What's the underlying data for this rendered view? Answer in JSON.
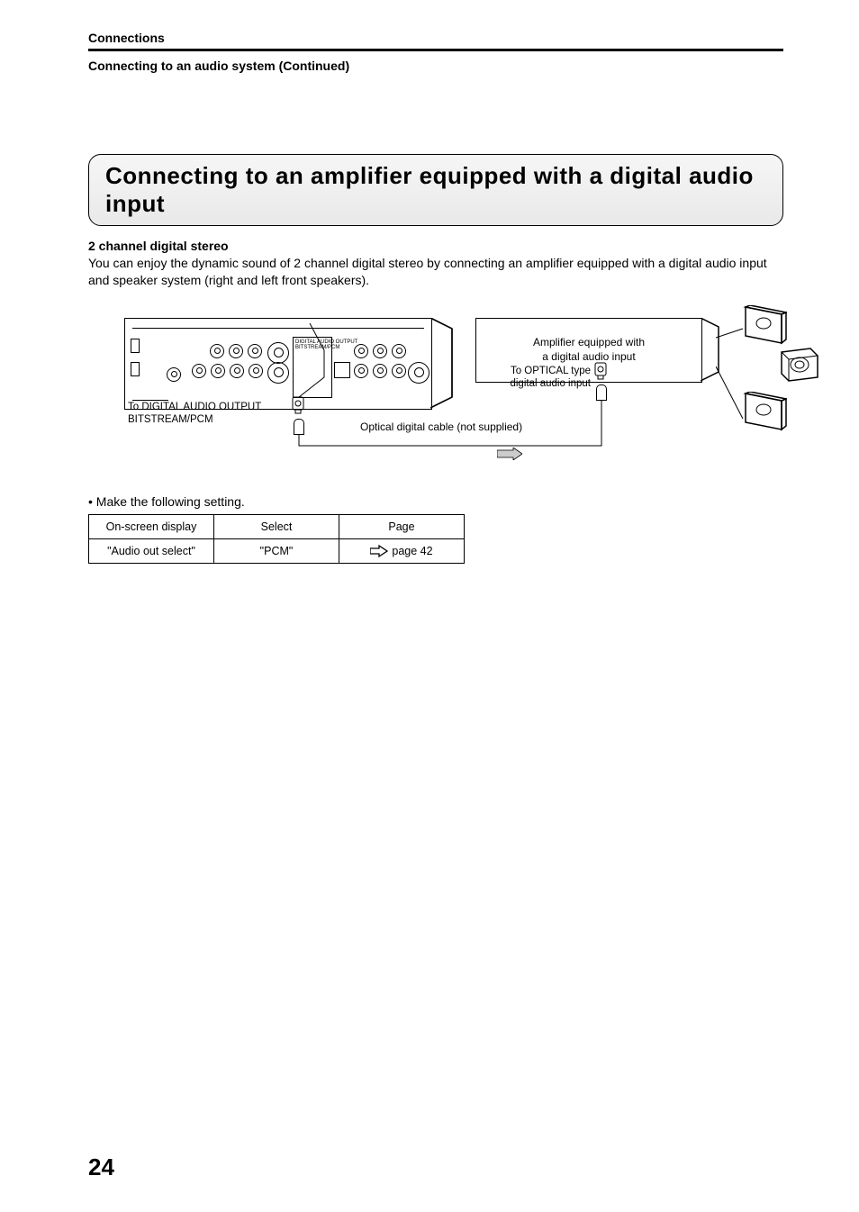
{
  "header": {
    "running": "Connections",
    "subsection": "Connecting to an audio system (Continued)"
  },
  "section": {
    "title": "Connecting to an amplifier equipped with a digital audio input",
    "subtitle": "2 channel digital stereo",
    "body": "You can enjoy the dynamic sound of 2 channel digital stereo by connecting an amplifier equipped with a digital audio input and speaker system (right and left front speakers)."
  },
  "diagram": {
    "player_label_top": "To DIGITAL AUDIO OUTPUT",
    "player_label_bottom": "BITSTREAM/PCM",
    "cable_label": "Optical digital cable (not supplied)",
    "amp_line1": "Amplifier equipped with",
    "amp_line2": "a digital audio input",
    "opt_label_top": "To OPTICAL type",
    "opt_label_bottom": "digital audio input",
    "panel_fine": "DIGITAL AUDIO OUTPUT\nBITSTREAM/PCM"
  },
  "settings": {
    "note": "• Make the following setting.",
    "headers": [
      "On-screen display",
      "Select",
      "Page"
    ],
    "row": {
      "osd": "\"Audio out select\"",
      "select": "\"PCM\"",
      "page": "page 42"
    }
  },
  "page_number": "24"
}
